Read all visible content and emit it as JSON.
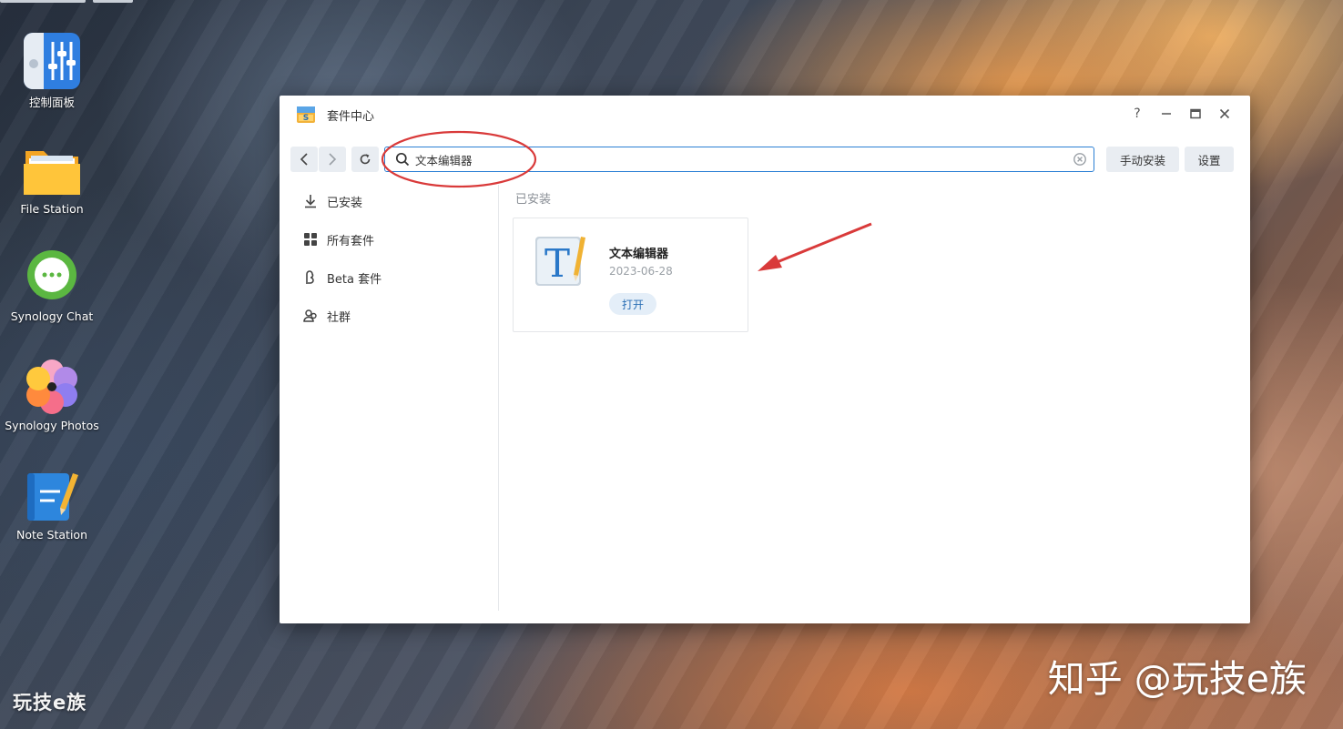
{
  "desktop": {
    "icons": [
      {
        "label": "控制面板",
        "icon": "control-panel-icon"
      },
      {
        "label": "File Station",
        "icon": "folder-icon"
      },
      {
        "label": "Synology Chat",
        "icon": "chat-bubble-icon"
      },
      {
        "label": "Synology Photos",
        "icon": "flower-photos-icon"
      },
      {
        "label": "Note Station",
        "icon": "notebook-pencil-icon"
      }
    ],
    "watermark_left": "玩技e族",
    "watermark_right": "知乎 @玩技e族"
  },
  "window": {
    "title": "套件中心",
    "controls": {
      "help": "?",
      "minimize": "—",
      "maximize": "□",
      "close": "✕"
    },
    "search": {
      "value": "文本编辑器",
      "placeholder": ""
    },
    "toolbar": {
      "manual_install": "手动安装",
      "settings": "设置"
    },
    "sidebar": {
      "items": [
        {
          "label": "已安装",
          "icon": "download-icon"
        },
        {
          "label": "所有套件",
          "icon": "grid-icon"
        },
        {
          "label": "Beta 套件",
          "icon": "beta-icon"
        },
        {
          "label": "社群",
          "icon": "community-icon"
        }
      ]
    },
    "main": {
      "section_title": "已安装",
      "packages": [
        {
          "name": "文本编辑器",
          "date": "2023-06-28",
          "action": "打开",
          "icon": "text-editor-icon"
        }
      ]
    }
  },
  "colors": {
    "accent": "#2b7fd4",
    "annotation_red": "#d93a3a",
    "button_bg": "#e9edf2"
  }
}
